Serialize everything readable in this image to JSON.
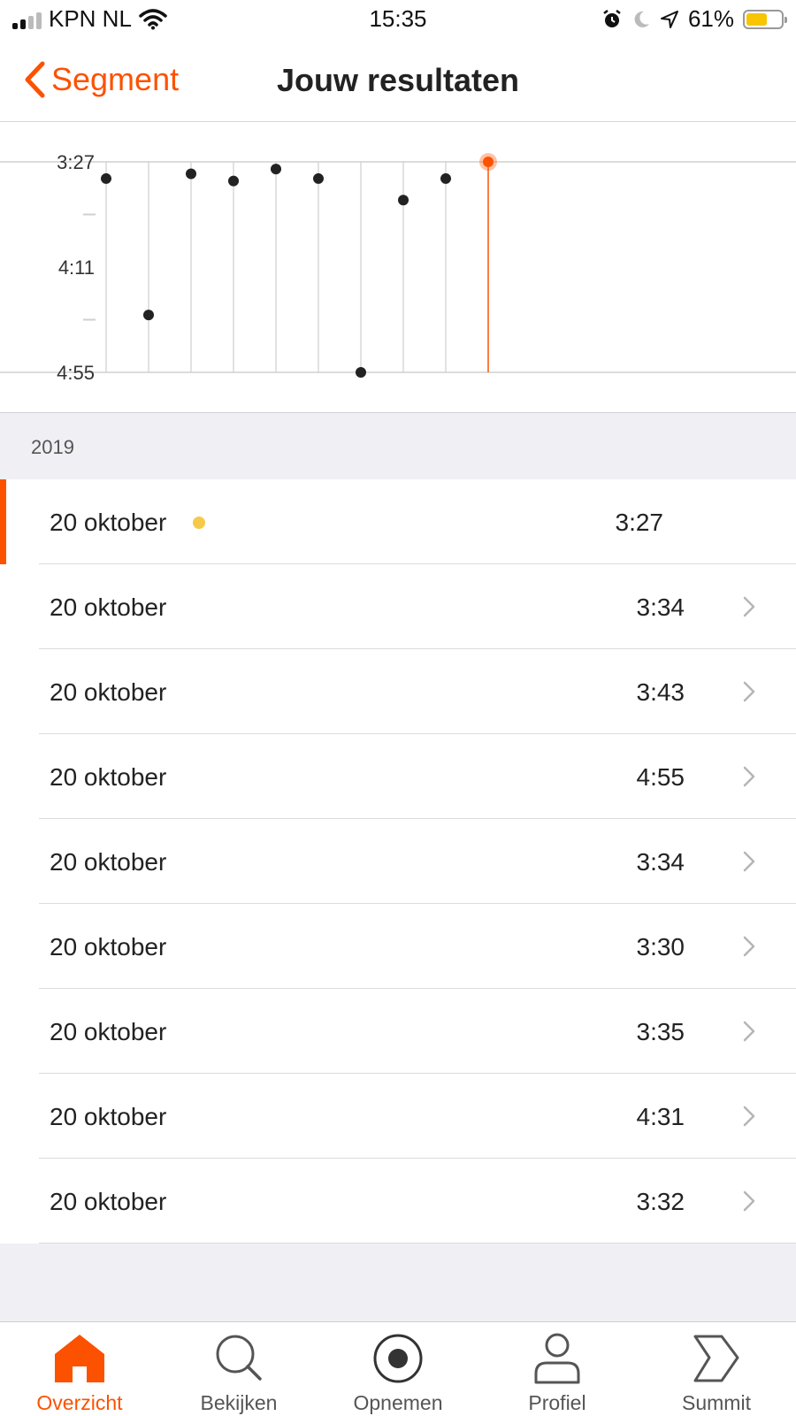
{
  "status_bar": {
    "carrier": "KPN NL",
    "time": "15:35",
    "battery": "61%",
    "battery_level": 0.61,
    "icons": [
      "signal-icon",
      "wifi-icon",
      "alarm-icon",
      "moon-icon",
      "location-icon",
      "battery-icon"
    ]
  },
  "nav": {
    "back_label": "Segment",
    "title": "Jouw resultaten"
  },
  "chart_data": {
    "type": "scatter",
    "title": "",
    "xlabel": "",
    "ylabel": "",
    "y_ticks": [
      "3:27",
      "4:11",
      "4:55"
    ],
    "ylim": [
      "4:55",
      "3:27"
    ],
    "y_inverted": true,
    "y_seconds": [
      207,
      251,
      295
    ],
    "points": [
      {
        "index": 1,
        "value": "3:34",
        "seconds": 214
      },
      {
        "index": 2,
        "value": "4:31",
        "seconds": 271
      },
      {
        "index": 3,
        "value": "3:32",
        "seconds": 212
      },
      {
        "index": 4,
        "value": "3:35",
        "seconds": 215
      },
      {
        "index": 5,
        "value": "3:30",
        "seconds": 210
      },
      {
        "index": 6,
        "value": "3:34",
        "seconds": 214
      },
      {
        "index": 7,
        "value": "4:55",
        "seconds": 295
      },
      {
        "index": 8,
        "value": "3:43",
        "seconds": 223
      },
      {
        "index": 9,
        "value": "3:34",
        "seconds": 214
      },
      {
        "index": 10,
        "value": "3:27",
        "seconds": 207,
        "highlight": true
      }
    ],
    "highlight_color": "#fc5200",
    "point_color": "#222222",
    "grid": true
  },
  "results": {
    "year": "2019",
    "rows": [
      {
        "date": "20 oktober",
        "time": "3:27",
        "active": true,
        "pr": true
      },
      {
        "date": "20 oktober",
        "time": "3:34"
      },
      {
        "date": "20 oktober",
        "time": "3:43"
      },
      {
        "date": "20 oktober",
        "time": "4:55"
      },
      {
        "date": "20 oktober",
        "time": "3:34"
      },
      {
        "date": "20 oktober",
        "time": "3:30"
      },
      {
        "date": "20 oktober",
        "time": "3:35"
      },
      {
        "date": "20 oktober",
        "time": "4:31"
      },
      {
        "date": "20 oktober",
        "time": "3:32"
      }
    ]
  },
  "tabbar": {
    "tabs": [
      {
        "label": "Overzicht",
        "icon": "home-icon",
        "selected": true
      },
      {
        "label": "Bekijken",
        "icon": "search-icon"
      },
      {
        "label": "Opnemen",
        "icon": "record-icon"
      },
      {
        "label": "Profiel",
        "icon": "profile-icon"
      },
      {
        "label": "Summit",
        "icon": "summit-icon"
      }
    ]
  },
  "colors": {
    "accent": "#fc5200",
    "pr_badge": "#f7c94a",
    "section_bg": "#f0f0f4"
  }
}
